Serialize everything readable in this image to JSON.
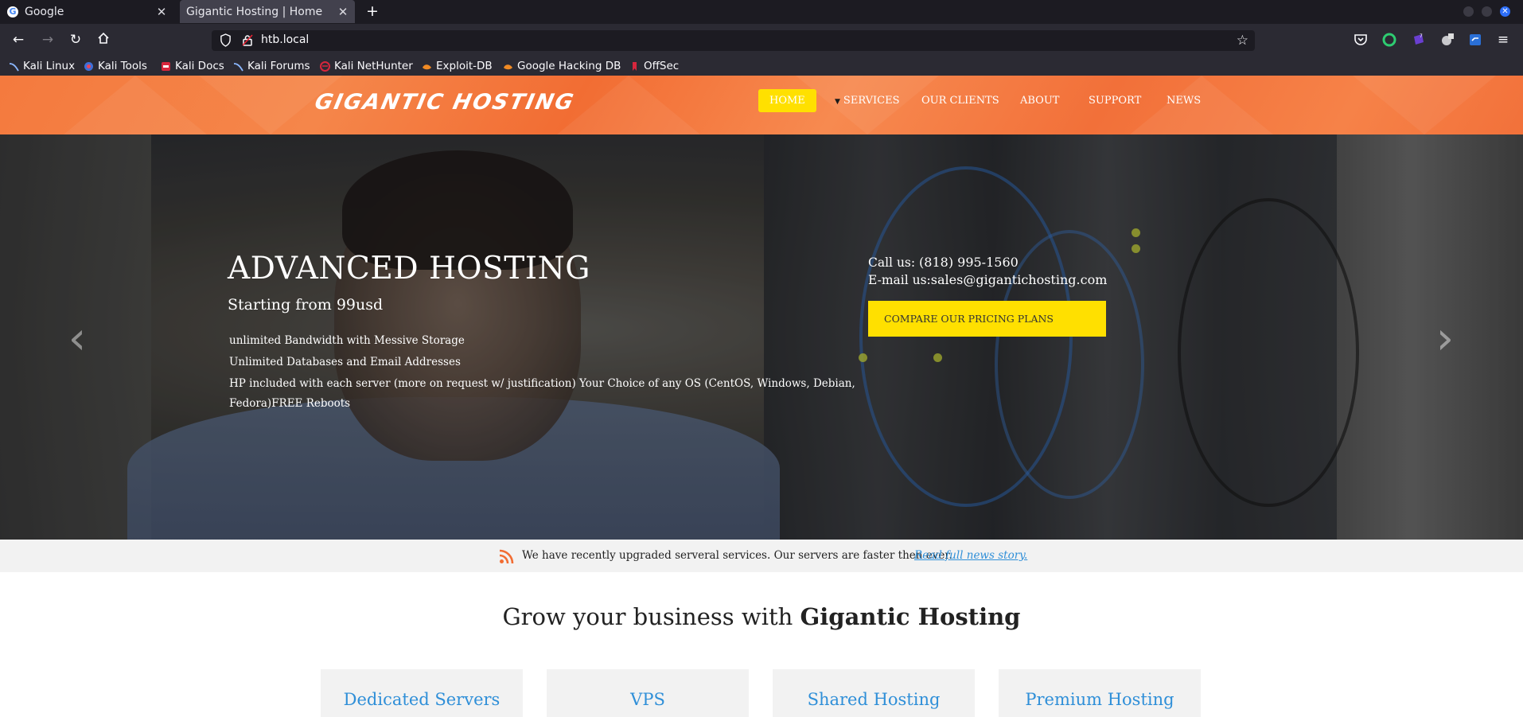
{
  "browser": {
    "tabs": [
      {
        "title": "Google",
        "icon": "google-icon"
      },
      {
        "title": "Gigantic Hosting | Home",
        "icon": ""
      }
    ],
    "url": "htb.local",
    "bookmarks": [
      {
        "label": "Kali Linux",
        "icon": "kali-icon"
      },
      {
        "label": "Kali Tools",
        "icon": "kali-tools-icon"
      },
      {
        "label": "Kali Docs",
        "icon": "kali-docs-icon"
      },
      {
        "label": "Kali Forums",
        "icon": "kali-icon"
      },
      {
        "label": "Kali NetHunter",
        "icon": "nethunter-icon"
      },
      {
        "label": "Exploit-DB",
        "icon": "exploit-db-icon"
      },
      {
        "label": "Google Hacking DB",
        "icon": "exploit-db-icon"
      },
      {
        "label": "OffSec",
        "icon": "offsec-icon"
      }
    ]
  },
  "site": {
    "logo": "GIGANTIC HOSTING",
    "menu": [
      "HOME",
      "SERVICES",
      "OUR CLIENTS",
      "ABOUT",
      "SUPPORT",
      "NEWS"
    ],
    "hero": {
      "title": "ADVANCED HOSTING",
      "subtitle": "Starting from 99usd",
      "features": [
        "unlimited Bandwidth with Messive Storage",
        "Unlimited Databases and Email Addresses",
        "HP included with each server (more on request w/ justification) Your Choice of any OS (CentOS, Windows, Debian,",
        "Fedora)FREE Reboots"
      ],
      "call_label": "Call us: ",
      "call_value": "(818) 995-1560",
      "email_label": "E-mail us:",
      "email_value": "sales@gigantichosting.com",
      "cta": "COMPARE OUR PRICING PLANS"
    },
    "news": {
      "text": "We have recently upgraded serveral services. Our servers are faster then ever.",
      "link": "Read full news story."
    },
    "grow": {
      "prefix": "Grow your business with ",
      "brand": "Gigantic Hosting"
    },
    "cards": [
      "Dedicated Servers",
      "VPS",
      "Shared Hosting",
      "Premium Hosting"
    ]
  },
  "colors": {
    "header_orange": "#f47a3e",
    "accent_yellow": "#ffe000",
    "link_blue": "#2f8fd8"
  }
}
